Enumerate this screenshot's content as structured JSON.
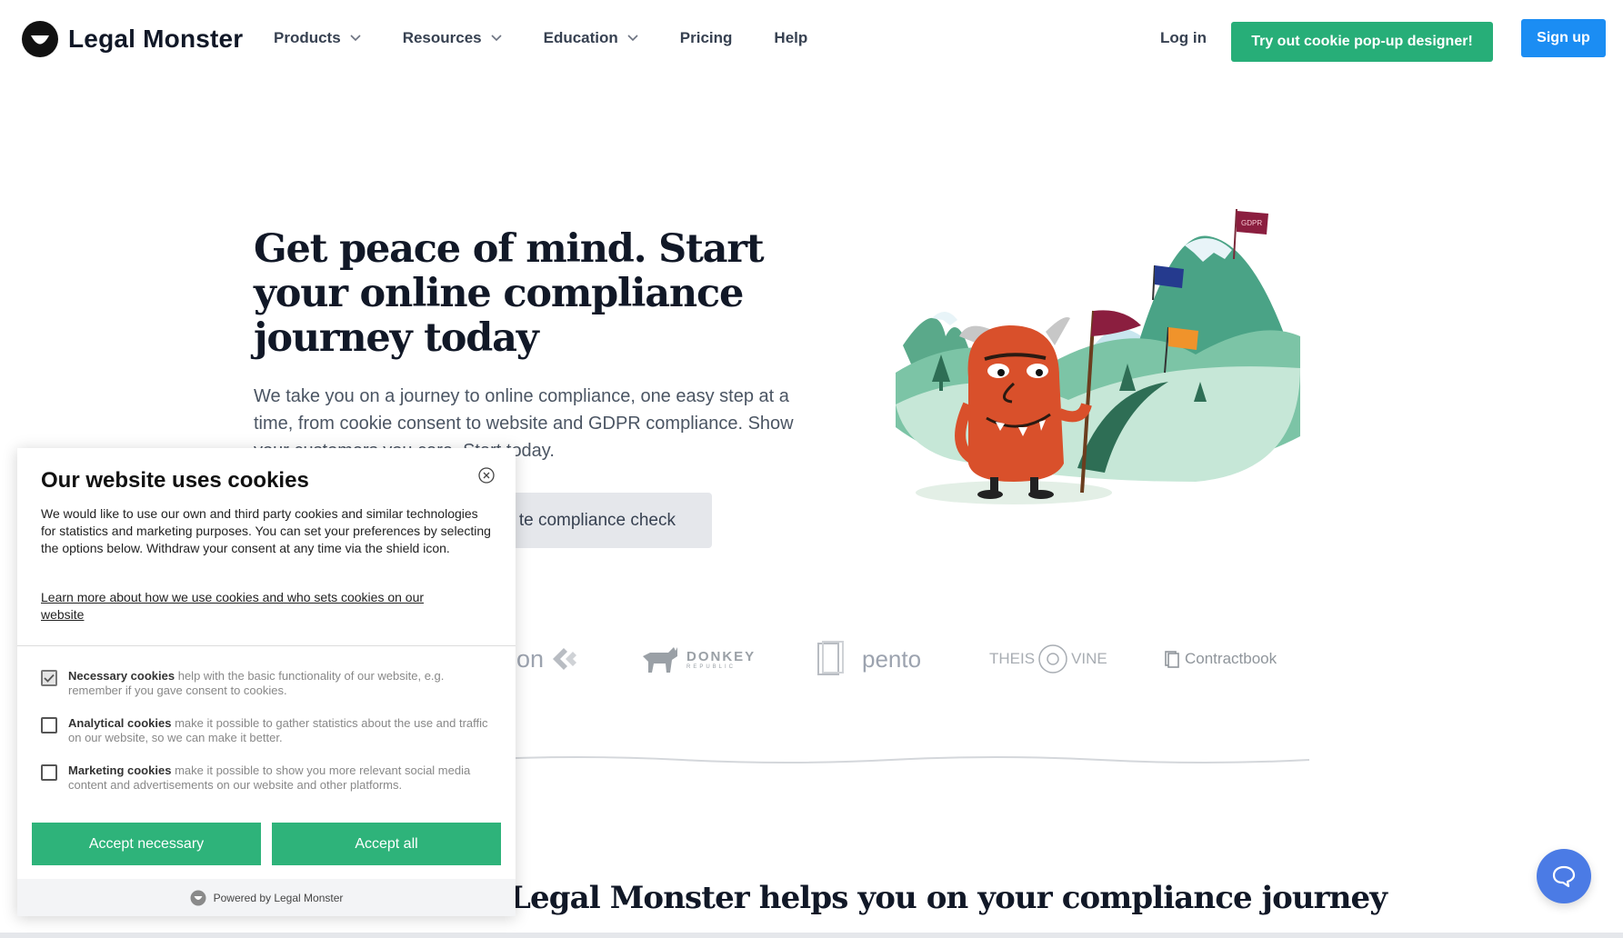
{
  "brand": {
    "name": "Legal Monster"
  },
  "nav": {
    "items": [
      {
        "label": "Products",
        "has_dropdown": true
      },
      {
        "label": "Resources",
        "has_dropdown": true
      },
      {
        "label": "Education",
        "has_dropdown": true
      },
      {
        "label": "Pricing",
        "has_dropdown": false
      },
      {
        "label": "Help",
        "has_dropdown": false
      }
    ],
    "login": "Log in",
    "try_button": "Try out cookie pop-up designer!",
    "signup": "Sign up"
  },
  "hero": {
    "title": "Get peace of mind. Start your online compliance journey today",
    "description": "We take you on a journey to online compliance, one easy step at a time, from cookie consent to website and GDPR compliance. Show your customers you care. Start today.",
    "cta": "te compliance check",
    "flag_label": "GDPR"
  },
  "clients": [
    "on",
    "DONKEY",
    "REPUBLIC",
    "pento",
    "THEIS",
    "VINE",
    "Contractbook"
  ],
  "section": {
    "title": "Legal Monster helps you on your compliance journey"
  },
  "cookie_dialog": {
    "title": "Our website uses cookies",
    "text": "We would like to use our own and third party cookies and similar technologies for statistics and marketing purposes. You can set your preferences by selecting the options below. Withdraw your consent at any time via the shield icon.",
    "link": "Learn more about how we use cookies and who sets cookies on our website",
    "options": [
      {
        "name": "Necessary cookies",
        "desc": "help with the basic functionality of our website, e.g. remember if you gave consent to cookies.",
        "checked": true
      },
      {
        "name": "Analytical cookies",
        "desc": "make it possible to gather statistics about the use and traffic on our website, so we can make it better.",
        "checked": false
      },
      {
        "name": "Marketing cookies",
        "desc": "make it possible to show you more relevant social media content and advertisements on our website and other platforms.",
        "checked": false
      }
    ],
    "accept_necessary": "Accept necessary",
    "accept_all": "Accept all",
    "powered_by": "Powered by Legal Monster"
  },
  "colors": {
    "brand_green": "#27ae78",
    "signup_blue": "#1b8df3",
    "cookie_green": "#2eb37a",
    "chat_blue": "#4b7be5",
    "monster_orange": "#d9502b"
  },
  "icons": [
    "logo-icon",
    "chevron-down-icon",
    "close-icon",
    "checkmark-icon",
    "chat-icon"
  ]
}
